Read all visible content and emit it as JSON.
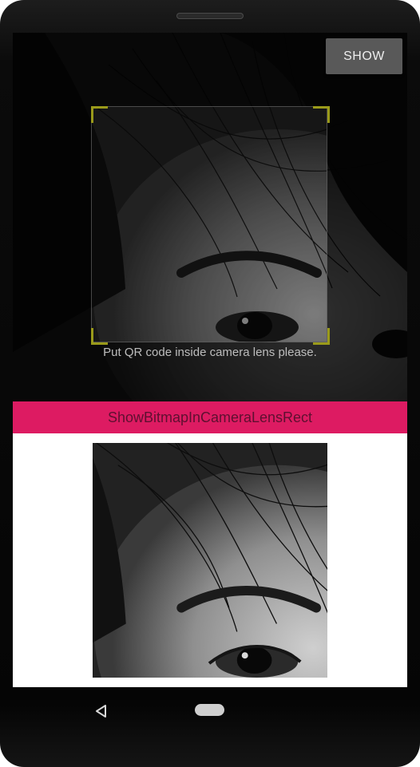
{
  "camera": {
    "hint_text": "Put QR code inside camera lens please."
  },
  "toolbar": {
    "show_label": "SHOW"
  },
  "title_bar": {
    "label": "ShowBitmapInCameraLensRect"
  },
  "icons": {
    "back": "back-triangle-icon",
    "home": "home-pill-icon"
  },
  "colors": {
    "accent": "#dd1b62",
    "corner": "#9a9a1a",
    "button_bg": "#595959"
  }
}
